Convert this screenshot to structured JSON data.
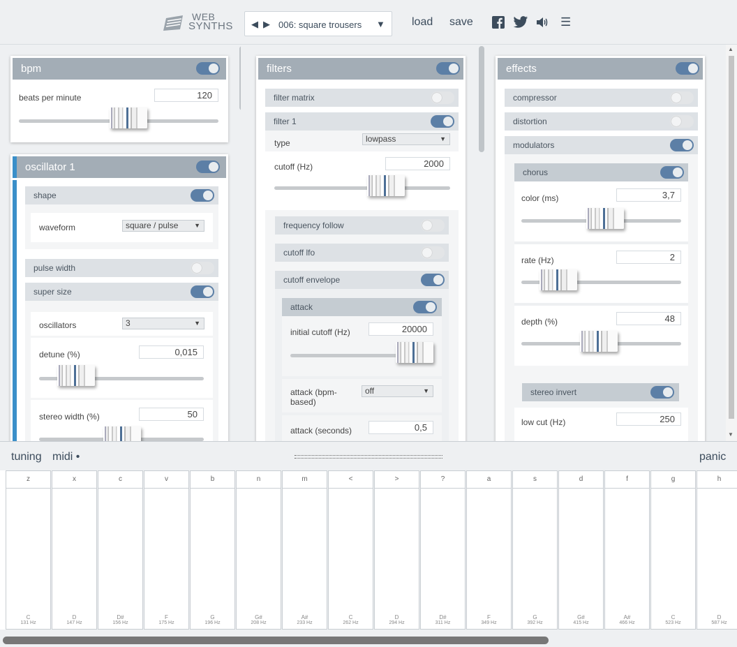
{
  "header": {
    "logo": [
      "WEB",
      "SYNTHS"
    ],
    "preset": {
      "prev": "◀",
      "next": "▶",
      "name": "006: square trousers",
      "dropdown": "▼"
    },
    "load": "load",
    "save": "save",
    "icons": [
      "facebook-icon",
      "twitter-icon",
      "speaker-icon",
      "menu-icon"
    ],
    "menu_glyph": "☰"
  },
  "bpm": {
    "title": "bpm",
    "label": "beats per minute",
    "value": "120",
    "slider_fraction": 0.55,
    "enabled": true
  },
  "oscillator": {
    "title": "oscillator 1",
    "enabled": true,
    "shape": {
      "label": "shape",
      "enabled": true,
      "waveform_label": "waveform",
      "waveform": "square / pulse"
    },
    "pulse_width": {
      "label": "pulse width",
      "enabled": false
    },
    "super_size": {
      "label": "super size",
      "enabled": true,
      "oscillators_label": "oscillators",
      "oscillators": "3",
      "detune_label": "detune (%)",
      "detune": "0,015",
      "detune_fraction": 0.1,
      "stereo_label": "stereo width (%)",
      "stereo": "50",
      "stereo_fraction": 0.45
    }
  },
  "filters": {
    "title": "filters",
    "enabled": true,
    "matrix": {
      "label": "filter matrix",
      "enabled": false
    },
    "filter1": {
      "label": "filter 1",
      "enabled": true,
      "type_label": "type",
      "type": "lowpass",
      "cutoff_label": "cutoff (Hz)",
      "cutoff": "2000",
      "cutoff_fraction": 0.6,
      "freq_follow": {
        "label": "frequency follow",
        "enabled": false
      },
      "cutoff_lfo": {
        "label": "cutoff lfo",
        "enabled": false
      },
      "cutoff_env": {
        "label": "cutoff envelope",
        "enabled": true
      },
      "attack": {
        "label": "attack",
        "enabled": true,
        "initial_label": "initial cutoff (Hz)",
        "initial": "20000",
        "initial_fraction": 1.0,
        "bpm_label_1": "attack (bpm-",
        "bpm_label_2": "based)",
        "bpm_value": "off",
        "seconds_label": "attack (seconds)",
        "seconds": "0,5"
      }
    }
  },
  "effects": {
    "title": "effects",
    "enabled": true,
    "compressor": {
      "label": "compressor",
      "enabled": false
    },
    "distortion": {
      "label": "distortion",
      "enabled": false
    },
    "modulators": {
      "label": "modulators",
      "enabled": true
    },
    "chorus": {
      "label": "chorus",
      "enabled": true,
      "color_label": "color (ms)",
      "color": "3,7",
      "color_fraction": 0.5,
      "rate_label": "rate (Hz)",
      "rate": "2",
      "rate_fraction": 0.15,
      "depth_label": "depth (%)",
      "depth": "48",
      "depth_fraction": 0.45,
      "stereo_invert": {
        "label": "stereo invert",
        "enabled": true
      }
    },
    "low_cut_label": "low cut (Hz)",
    "low_cut": "250"
  },
  "bottom": {
    "tuning": "tuning",
    "midi": "midi •",
    "panic": "panic"
  },
  "keys": [
    {
      "key": "z",
      "note": "C",
      "freq": "131 Hz"
    },
    {
      "key": "x",
      "note": "D",
      "freq": "147 Hz"
    },
    {
      "key": "c",
      "note": "D#",
      "freq": "156 Hz"
    },
    {
      "key": "v",
      "note": "F",
      "freq": "175 Hz"
    },
    {
      "key": "b",
      "note": "G",
      "freq": "196 Hz"
    },
    {
      "key": "n",
      "note": "G#",
      "freq": "208 Hz"
    },
    {
      "key": "m",
      "note": "A#",
      "freq": "233 Hz"
    },
    {
      "key": "<",
      "note": "C",
      "freq": "262 Hz"
    },
    {
      "key": ">",
      "note": "D",
      "freq": "294 Hz"
    },
    {
      "key": "?",
      "note": "D#",
      "freq": "311 Hz"
    },
    {
      "key": "a",
      "note": "F",
      "freq": "349 Hz"
    },
    {
      "key": "s",
      "note": "G",
      "freq": "392 Hz"
    },
    {
      "key": "d",
      "note": "G#",
      "freq": "415 Hz"
    },
    {
      "key": "f",
      "note": "A#",
      "freq": "466 Hz"
    },
    {
      "key": "g",
      "note": "C",
      "freq": "523 Hz"
    },
    {
      "key": "h",
      "note": "D",
      "freq": "587 Hz"
    }
  ],
  "colors": {
    "accent": "#3a8fc9",
    "toggle_on": "#5c7fa6",
    "header": "#a3adb6"
  }
}
